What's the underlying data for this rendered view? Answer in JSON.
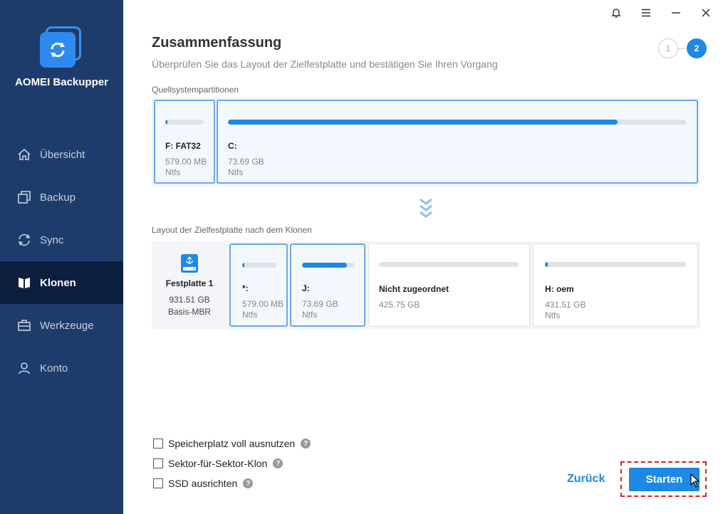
{
  "app": {
    "name": "AOMEI Backupper"
  },
  "sidebar": {
    "items": [
      {
        "label": "Übersicht",
        "icon": "home-icon",
        "active": false
      },
      {
        "label": "Backup",
        "icon": "backup-icon",
        "active": false
      },
      {
        "label": "Sync",
        "icon": "sync-icon",
        "active": false
      },
      {
        "label": "Klonen",
        "icon": "clone-icon",
        "active": true
      },
      {
        "label": "Werkzeuge",
        "icon": "toolbox-icon",
        "active": false
      },
      {
        "label": "Konto",
        "icon": "user-icon",
        "active": false
      }
    ]
  },
  "header": {
    "title": "Zusammenfassung",
    "subtitle": "Überprüfen Sie das Layout der Zielfestplatte und bestätigen Sie Ihren Vorgang",
    "steps": [
      "1",
      "2"
    ],
    "current_step": "2"
  },
  "source": {
    "label": "Quellsystempartitionen",
    "partitions": [
      {
        "name": "F: FAT32",
        "size": "579.00 MB",
        "fs": "Ntfs",
        "used_fraction": 0.06
      },
      {
        "name": "C:",
        "size": "73.69 GB",
        "fs": "Ntfs",
        "used_fraction": 0.85
      }
    ]
  },
  "destination": {
    "label": "Layout der Zielfestplatte nach dem Klonen",
    "disk": {
      "name": "Festplatte 1",
      "size": "931.51 GB",
      "type": "Basis-MBR"
    },
    "partitions": [
      {
        "name": "*:",
        "size": "579.00 MB",
        "fs": "Ntfs",
        "used_fraction": 0.06
      },
      {
        "name": "J:",
        "size": "73.69 GB",
        "fs": "Ntfs",
        "used_fraction": 0.85
      },
      {
        "name": "Nicht zugeordnet",
        "size": "425.75 GB",
        "fs": "",
        "used_fraction": 0
      },
      {
        "name": "H: oem",
        "size": "431.51 GB",
        "fs": "Ntfs",
        "used_fraction": 0.02
      }
    ]
  },
  "options": [
    {
      "label": "Speicherplatz voll ausnutzen",
      "checked": false
    },
    {
      "label": "Sektor-für-Sektor-Klon",
      "checked": false
    },
    {
      "label": "SSD ausrichten",
      "checked": false
    }
  ],
  "help_glyph": "?",
  "buttons": {
    "back": "Zurück",
    "start": "Starten"
  },
  "colors": {
    "sidebar": "#1e3c6b",
    "sidebar_active": "#0c1f3f",
    "accent": "#1e88e5",
    "highlight": "#e02020"
  }
}
